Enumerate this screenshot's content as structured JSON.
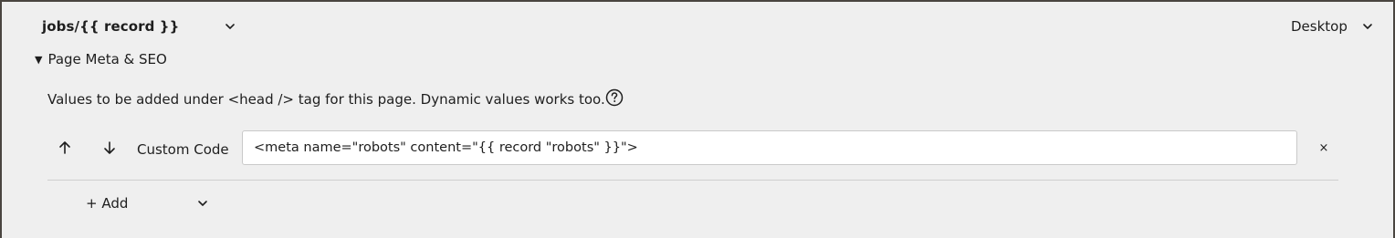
{
  "header": {
    "page_route": "jobs/{{ record }}",
    "device": "Desktop"
  },
  "section": {
    "toggle_glyph": "▼",
    "title": "Page Meta & SEO",
    "description": "Values to be added under <head /> tag for this page. Dynamic values works too."
  },
  "meta_items": [
    {
      "type_label": "Custom Code",
      "value": "<meta name=\"robots\" content=\"{{ record \"robots\" }}\">",
      "remove_glyph": "×"
    }
  ],
  "add": {
    "label": "+ Add"
  },
  "icons": {
    "route_dropdown": "chevron-down-icon",
    "device_dropdown": "chevron-down-icon",
    "help": "help-circle-icon",
    "move_up": "arrow-up-icon",
    "move_down": "arrow-down-icon",
    "add_dropdown": "chevron-down-icon"
  },
  "colors": {
    "background": "#efefef",
    "text": "#1e1e1e",
    "input_background": "#ffffff",
    "divider": "#cfcfcf"
  }
}
